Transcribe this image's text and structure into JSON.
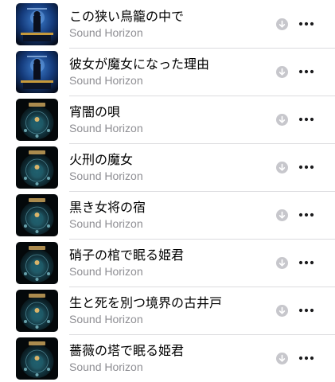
{
  "playlist": {
    "tracks": [
      {
        "title": "この狭い鳥籠の中で",
        "artist": "Sound Horizon",
        "artwork": "album-a"
      },
      {
        "title": "彼女が魔女になった理由",
        "artist": "Sound Horizon",
        "artwork": "album-a"
      },
      {
        "title": "宵闇の唄",
        "artist": "Sound Horizon",
        "artwork": "album-b"
      },
      {
        "title": "火刑の魔女",
        "artist": "Sound Horizon",
        "artwork": "album-b"
      },
      {
        "title": "黒き女将の宿",
        "artist": "Sound Horizon",
        "artwork": "album-b"
      },
      {
        "title": "硝子の棺で眠る姫君",
        "artist": "Sound Horizon",
        "artwork": "album-b"
      },
      {
        "title": "生と死を別つ境界の古井戸",
        "artist": "Sound Horizon",
        "artwork": "album-b"
      },
      {
        "title": "薔薇の塔で眠る姫君",
        "artist": "Sound Horizon",
        "artwork": "album-b"
      }
    ]
  },
  "icons": {
    "download": "download-icon",
    "more": "more-icon"
  },
  "colors": {
    "title": "#000000",
    "subtitle": "#8e8e93",
    "icon_gray": "#c7c7cc",
    "more_dots": "#1c1c1e",
    "separator": "#dcdcdf"
  }
}
